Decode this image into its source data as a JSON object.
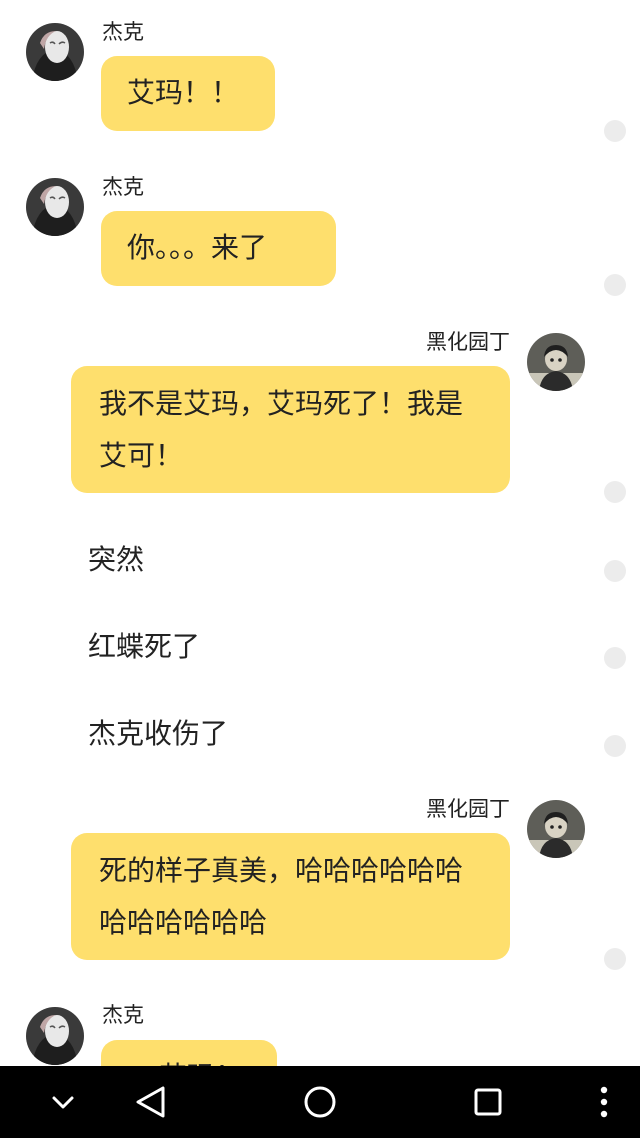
{
  "messages": [
    {
      "sender": "杰克",
      "text": "艾玛！！"
    },
    {
      "sender": "杰克",
      "text": "你。。。来了"
    },
    {
      "sender": "黑化园丁",
      "text": "我不是艾玛，艾玛死了！我是艾可！"
    },
    {
      "narration": "突然"
    },
    {
      "narration": "红蝶死了"
    },
    {
      "narration": "杰克收伤了"
    },
    {
      "sender": "黑化园丁",
      "text": "死的样子真美，哈哈哈哈哈哈哈哈哈哈哈哈"
    },
    {
      "sender": "杰克",
      "text": "艾玛！"
    }
  ],
  "colors": {
    "bubble": "#fedf6d",
    "text": "#222222",
    "status_dot": "#ececec",
    "nav_bar": "#000000"
  },
  "navbar": {
    "icons": [
      "chevron-down-icon",
      "back-triangle-icon",
      "home-circle-icon",
      "recents-square-icon",
      "more-vertical-icon"
    ]
  }
}
